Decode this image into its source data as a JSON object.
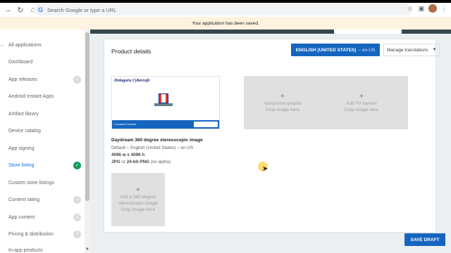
{
  "browser": {
    "back_icon": "arrow-back-icon",
    "reload_icon": "reload-icon",
    "home_icon": "home-icon",
    "search_placeholder": "Search Google or type a URL"
  },
  "banner": {
    "message": "Your application has been saved."
  },
  "sidebar": {
    "items": [
      {
        "label": "All applications",
        "lead": "←",
        "status": "none"
      },
      {
        "label": "Dashboard",
        "status": "none"
      },
      {
        "label": "App releases",
        "status": "pending"
      },
      {
        "label": "Android Instant Apps",
        "status": "none"
      },
      {
        "label": "Artifact library",
        "status": "none"
      },
      {
        "label": "Device catalog",
        "status": "none"
      },
      {
        "label": "App signing",
        "status": "none"
      },
      {
        "label": "Store listing",
        "status": "done",
        "active": true
      },
      {
        "label": "Custom store listings",
        "status": "none"
      },
      {
        "label": "Content rating",
        "status": "pending"
      },
      {
        "label": "App content",
        "status": "pending"
      },
      {
        "label": "Pricing & distribution",
        "status": "pending"
      },
      {
        "label": "In-app products",
        "status": "none"
      }
    ]
  },
  "card": {
    "title": "Product details",
    "language_button": "ENGLISH (UNITED STATES)",
    "language_code": "– en-US",
    "manage_translations": "Manage translations"
  },
  "feature_graphic": {
    "title": "Dnlaguru Cybercafe",
    "footer_brand": "Constant Contact"
  },
  "slots": {
    "promo": {
      "plus": "+",
      "line1": "Add promo graphic",
      "line2": "Drop image here"
    },
    "tv": {
      "plus": "+",
      "line1": "Add TV banner",
      "line2": "Drop image here"
    },
    "vr": {
      "plus": "+",
      "line1": "Add a 360 degree",
      "line2": "stereoscopic image",
      "line3": "Drop image here"
    }
  },
  "vr_info": {
    "title": "Daydream 360 degree stereoscopic image",
    "default": "Default – English (United States) – en-US",
    "size": "4096 w x 4096 h",
    "format_bold_1": "JPG",
    "format_mid": " or ",
    "format_bold_2": "24-bit PNG",
    "format_tail": " (no alpha)"
  },
  "footer": {
    "save_draft": "SAVE DRAFT"
  },
  "colors": {
    "accent": "#1565c0",
    "banner_bg": "#fdf3e0",
    "check_done": "#0f9d58",
    "check_pending": "#dadce0"
  }
}
